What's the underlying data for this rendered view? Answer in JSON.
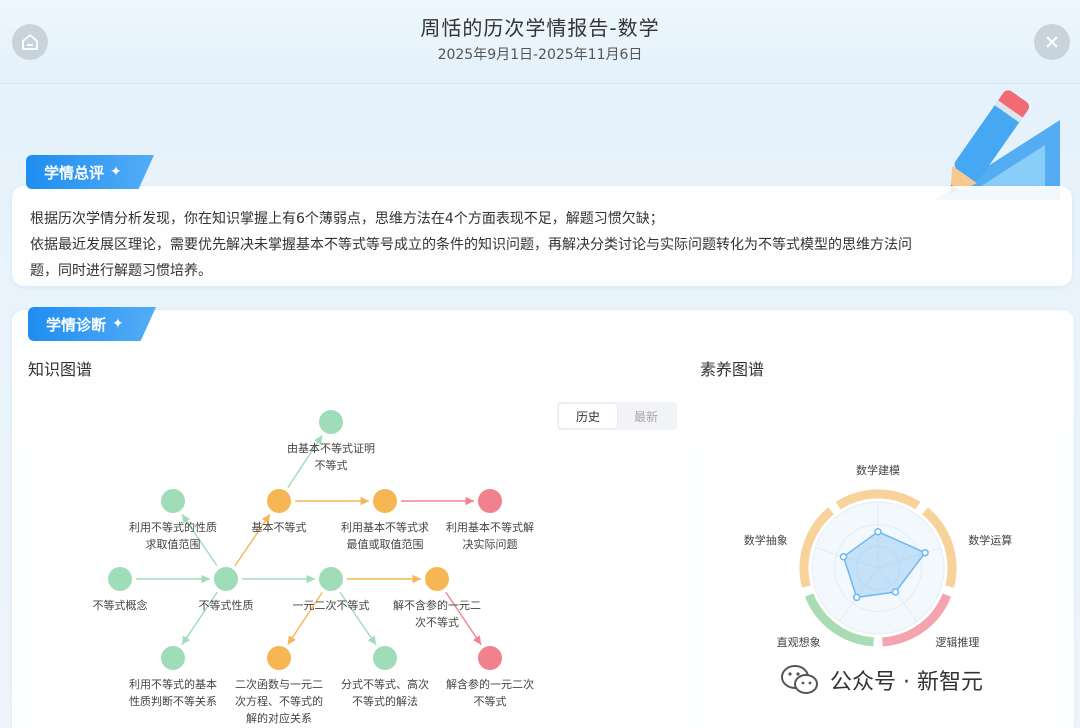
{
  "header": {
    "title": "周恬的历次学情报告-数学",
    "date_range": "2025年9月1日-2025年11月6日"
  },
  "summary": {
    "section_label": "学情总评",
    "lines": [
      "根据历次学情分析发现，你在知识掌握上有6个薄弱点，思维方法在4个方面表现不足，解题习惯欠缺；",
      "依据最近发展区理论，需要优先解决未掌握基本不等式等号成立的条件的知识问题，再解决分类讨论与实际问题转化为不等式模型的思维方法问",
      "题，同时进行解题习惯培养。"
    ]
  },
  "diagnosis": {
    "section_label": "学情诊断",
    "knowledge_map_title": "知识图谱",
    "literacy_map_title": "素养图谱",
    "toggle": {
      "history": "历史",
      "latest": "最新"
    }
  },
  "knowledge_nodes": [
    {
      "id": "n1",
      "lines": [
        "由基本不等式证明",
        "不等式"
      ],
      "status": "green"
    },
    {
      "id": "n2",
      "lines": [
        "基本不等式"
      ],
      "status": "orange"
    },
    {
      "id": "n3",
      "lines": [
        "利用基本不等式求",
        "最值或取值范围"
      ],
      "status": "orange"
    },
    {
      "id": "n4",
      "lines": [
        "利用基本不等式解",
        "决实际问题"
      ],
      "status": "red"
    },
    {
      "id": "n5",
      "lines": [
        "利用不等式的性质",
        "求取值范围"
      ],
      "status": "green"
    },
    {
      "id": "n6",
      "lines": [
        "不等式概念"
      ],
      "status": "green"
    },
    {
      "id": "n7",
      "lines": [
        "不等式性质"
      ],
      "status": "green"
    },
    {
      "id": "n8",
      "lines": [
        "一元二次不等式"
      ],
      "status": "green"
    },
    {
      "id": "n9",
      "lines": [
        "解不含参的一元二",
        "次不等式"
      ],
      "status": "orange"
    },
    {
      "id": "n10",
      "lines": [
        "利用不等式的基本",
        "性质判断不等关系"
      ],
      "status": "green"
    },
    {
      "id": "n11",
      "lines": [
        "二次函数与一元二",
        "次方程、不等式的",
        "解的对应关系"
      ],
      "status": "orange"
    },
    {
      "id": "n12",
      "lines": [
        "分式不等式、高次",
        "不等式的解法"
      ],
      "status": "green"
    },
    {
      "id": "n13",
      "lines": [
        "解含参的一元二次",
        "不等式"
      ],
      "status": "red"
    }
  ],
  "knowledge_edges": [
    [
      "n2",
      "n1"
    ],
    [
      "n2",
      "n3"
    ],
    [
      "n3",
      "n4"
    ],
    [
      "n7",
      "n5"
    ],
    [
      "n6",
      "n7"
    ],
    [
      "n7",
      "n2"
    ],
    [
      "n7",
      "n8"
    ],
    [
      "n7",
      "n10"
    ],
    [
      "n8",
      "n9"
    ],
    [
      "n8",
      "n11"
    ],
    [
      "n8",
      "n12"
    ],
    [
      "n9",
      "n13"
    ]
  ],
  "status_colors": {
    "green": "#9fdcb8",
    "orange": "#f6b654",
    "red": "#f2818e"
  },
  "literacy_radar": {
    "axes": [
      "数学建模",
      "数学运算",
      "逻辑推理",
      "直观想象",
      "数学抽象"
    ],
    "values": [
      0.55,
      0.75,
      0.45,
      0.55,
      0.55
    ],
    "ring_colors": [
      "#f7d29a",
      "#f7d29a",
      "#f4a4ae",
      "#a8dcb5",
      "#f7d29a"
    ],
    "fill_color": "#6cb8f2"
  },
  "watermark": {
    "text": "公众号 · 新智元"
  }
}
